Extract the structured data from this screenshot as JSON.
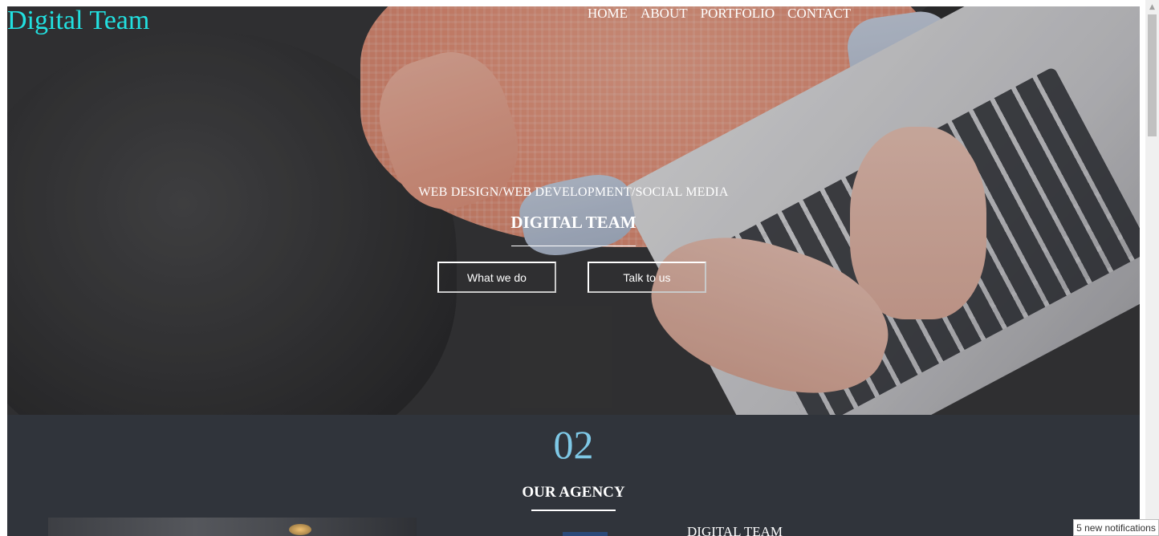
{
  "header": {
    "logo": "Digital Team",
    "nav": [
      "HOME",
      "ABOUT",
      "PORTFOLIO",
      "CONTACT"
    ]
  },
  "hero": {
    "tagline": "WEB DESIGN/WEB DEVELOPMENT/SOCIAL MEDIA",
    "title": "DIGITAL TEAM",
    "buttons": [
      "What we do",
      "Talk to us"
    ]
  },
  "agency": {
    "number": "02",
    "title": "OUR AGENCY",
    "subtitle": "DIGITAL TEAM"
  },
  "notification": "5 new notifications",
  "colors": {
    "logo": "#22e0e0",
    "section_bg": "#30343b",
    "number": "#7ec8e6"
  }
}
